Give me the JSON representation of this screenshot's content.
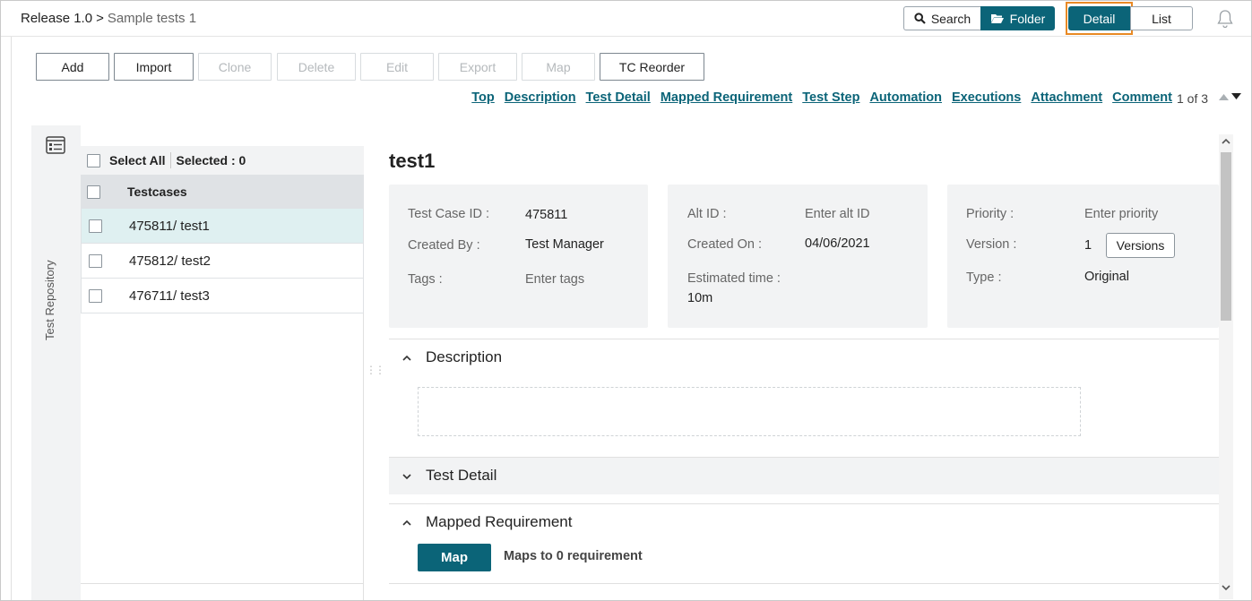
{
  "breadcrumb": {
    "root": "Release 1.0",
    "separator": ">",
    "current": "Sample tests 1"
  },
  "view_toggle": {
    "search": "Search",
    "folder": "Folder",
    "detail": "Detail",
    "list": "List"
  },
  "toolbar": {
    "add": "Add",
    "import": "Import",
    "clone": "Clone",
    "delete": "Delete",
    "edit": "Edit",
    "export": "Export",
    "map": "Map",
    "reorder": "TC Reorder"
  },
  "anchors": [
    "Top",
    "Description",
    "Test Detail",
    "Mapped Requirement",
    "Test Step",
    "Automation",
    "Executions",
    "Attachment",
    "Comment"
  ],
  "pager": "1 of 3",
  "rail": {
    "label": "Test Repository"
  },
  "tree": {
    "select_all": "Select All",
    "selected": "Selected : 0",
    "column": "Testcases",
    "rows": [
      {
        "label": "475811/ test1"
      },
      {
        "label": "475812/ test2"
      },
      {
        "label": "476711/ test3"
      }
    ]
  },
  "testcase": {
    "title": "test1",
    "card1": {
      "id_label": "Test Case ID :",
      "id_value": "475811",
      "created_by_label": "Created By :",
      "created_by_value": "Test Manager",
      "tags_label": "Tags :",
      "tags_placeholder": "Enter tags"
    },
    "card2": {
      "alt_label": "Alt ID :",
      "alt_placeholder": "Enter alt ID",
      "created_on_label": "Created On :",
      "created_on_value": "04/06/2021",
      "est_label": "Estimated time :",
      "est_value": "10m"
    },
    "card3": {
      "priority_label": "Priority :",
      "priority_placeholder": "Enter priority",
      "version_label": "Version :",
      "version_value": "1",
      "versions_button": "Versions",
      "type_label": "Type :",
      "type_value": "Original"
    }
  },
  "sections": {
    "description": "Description",
    "test_detail": "Test Detail",
    "mapped_requirement": "Mapped Requirement",
    "map_button": "Map",
    "maps_text": "Maps to 0 requirement"
  },
  "colors": {
    "primary": "#0b6478",
    "highlight": "#e98a25",
    "selected_row": "#dff0f1"
  }
}
